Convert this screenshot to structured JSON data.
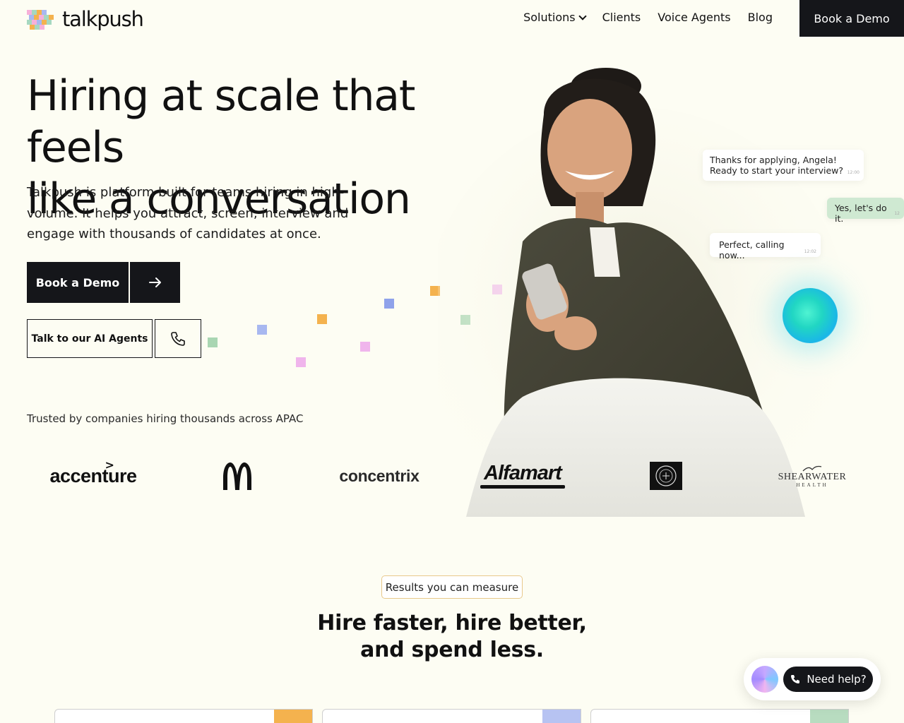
{
  "brand": {
    "name": "talkpush"
  },
  "nav": {
    "links": [
      {
        "label": "Solutions"
      },
      {
        "label": "Clients"
      },
      {
        "label": "Voice Agents"
      },
      {
        "label": "Blog"
      }
    ],
    "cta": "Book a Demo"
  },
  "hero": {
    "title_line1": "Hiring at scale that feels",
    "title_line2": "like a conversation",
    "subtitle": "Talkpush is platform built for teams hiring in high-volume. It helps you attract, screen, interview and engage with thousands of candidates at once.",
    "primary_cta": "Book a Demo",
    "secondary_cta": "Talk to our AI Agents"
  },
  "chat": {
    "msg1_line1": "Thanks for applying, Angela!",
    "msg1_line2": "Ready to start your interview?",
    "msg1_time": "12:00",
    "msg2": "Yes, let's do it.",
    "msg2_time": "12",
    "msg3": "Perfect, calling now...",
    "msg3_time": "12:02"
  },
  "trusted": {
    "label": "Trusted by companies hiring thousands across APAC",
    "logos": [
      {
        "name": "accenture"
      },
      {
        "name": "McDonald's"
      },
      {
        "name": "concentrix"
      },
      {
        "name": "Alfamart"
      },
      {
        "name": "The Coffee Bean & Tea Leaf"
      },
      {
        "name": "SHEARWATER",
        "sub": "HEALTH"
      }
    ]
  },
  "results": {
    "pill": "Results you can measure",
    "title_line1": "Hire faster, hire better,",
    "title_line2": "and spend less."
  },
  "help_widget": {
    "label": "Need help?"
  },
  "colors": {
    "background": "#fdfdf3",
    "dark": "#15161a",
    "accent_orange": "#f4b24e",
    "accent_blue": "#a8b8f0",
    "accent_green": "#a9d6b2"
  }
}
